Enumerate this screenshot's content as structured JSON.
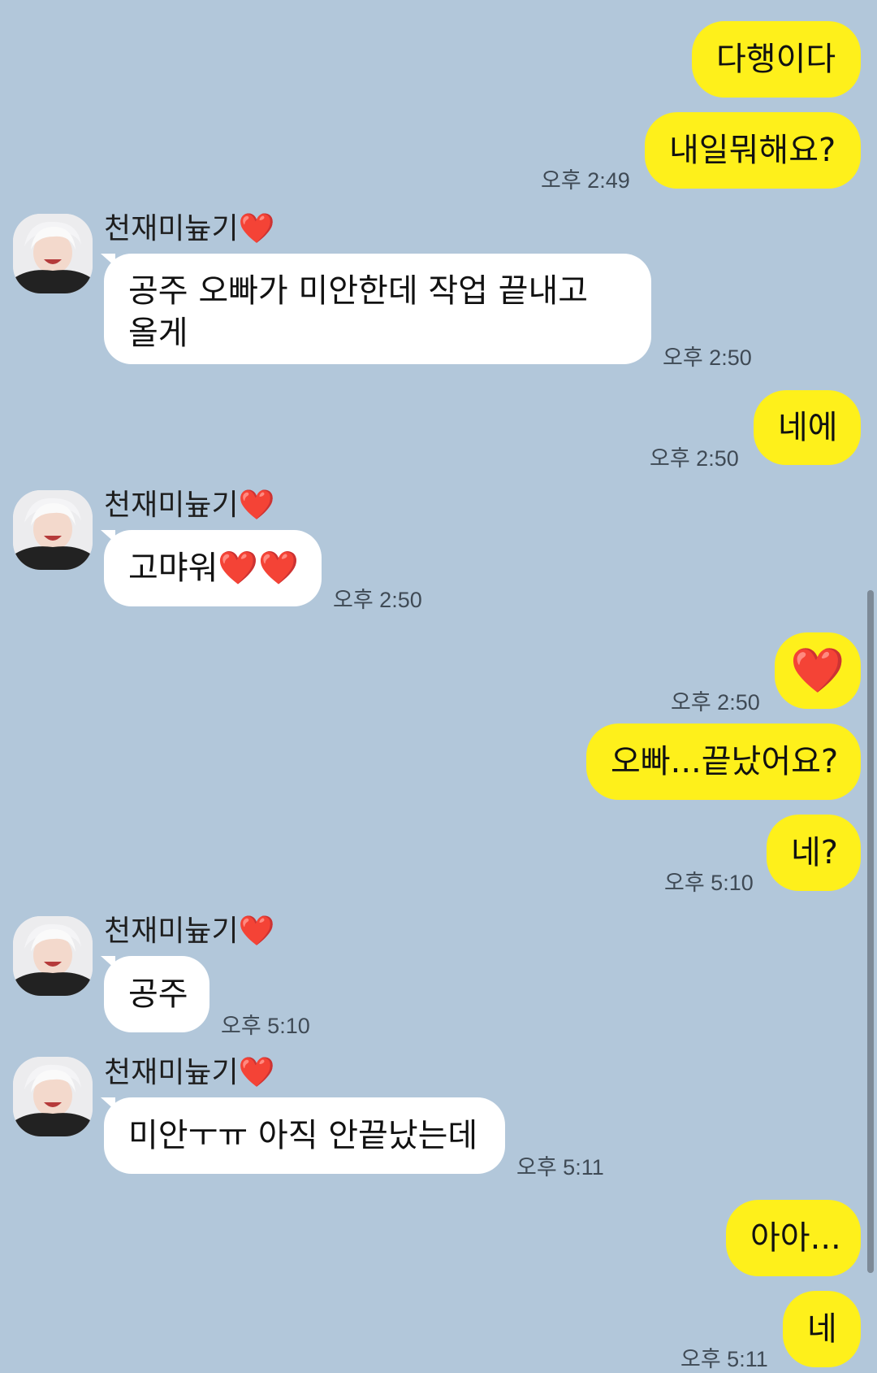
{
  "partner_name": "천재미늎기❤️",
  "messages": [
    {
      "text": "다행이다"
    },
    {
      "text": "내일뭐해요?",
      "time": "오후 2:49"
    },
    {
      "text": "공주 오빠가 미안한데 작업 끝내고 올게",
      "time": "오후 2:50"
    },
    {
      "text": "네에",
      "time": "오후 2:50"
    },
    {
      "text": "고먀워❤️❤️",
      "time": "오후 2:50"
    },
    {
      "text": "❤️",
      "time": "오후 2:50"
    },
    {
      "text": "오빠...끝났어요?"
    },
    {
      "text": "네?",
      "time": "오후 5:10"
    },
    {
      "text": "공주",
      "time": "오후 5:10"
    },
    {
      "text": "미안ㅜㅠ 아직 안끝났는데",
      "time": "오후 5:11"
    },
    {
      "text": "아아..."
    },
    {
      "text": "네",
      "time": "오후 5:11"
    }
  ],
  "colors": {
    "background": "#b2c7da",
    "my_bubble": "#fef01b",
    "their_bubble": "#ffffff",
    "heart": "#e41a22"
  },
  "icons": [
    "avatar",
    "heart-emoji"
  ]
}
